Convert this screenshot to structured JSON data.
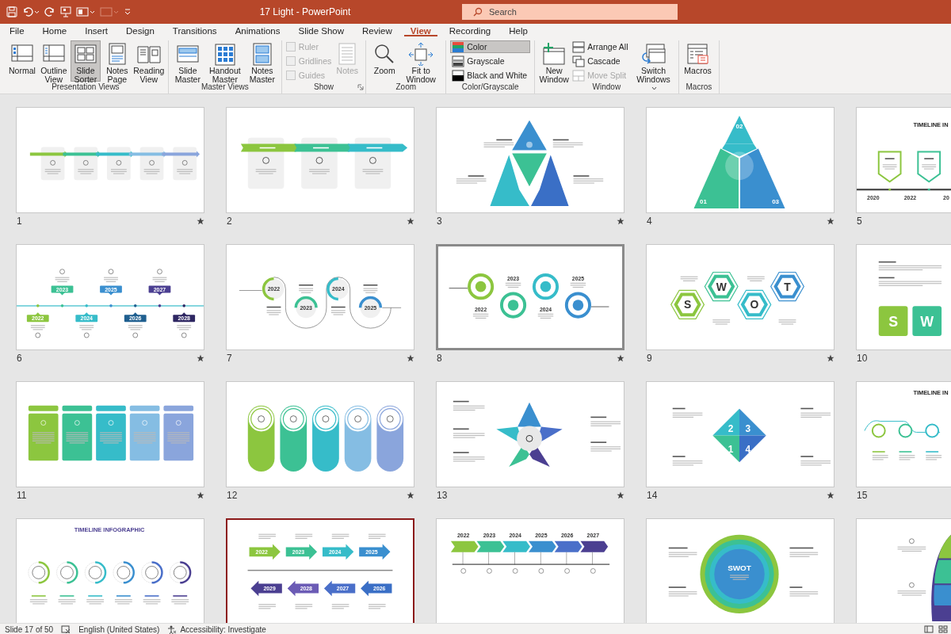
{
  "window": {
    "title": "17 Light  -  PowerPoint",
    "search": {
      "placeholder": "Search"
    }
  },
  "tabs": [
    {
      "label": "File",
      "selected": false
    },
    {
      "label": "Home",
      "selected": false
    },
    {
      "label": "Insert",
      "selected": false
    },
    {
      "label": "Design",
      "selected": false
    },
    {
      "label": "Transitions",
      "selected": false
    },
    {
      "label": "Animations",
      "selected": false
    },
    {
      "label": "Slide Show",
      "selected": false
    },
    {
      "label": "Review",
      "selected": false
    },
    {
      "label": "View",
      "selected": true
    },
    {
      "label": "Recording",
      "selected": false
    },
    {
      "label": "Help",
      "selected": false
    }
  ],
  "ribbon": [
    {
      "label": "Presentation Views",
      "items": [
        {
          "label": "Normal",
          "kind": "large",
          "selected": false,
          "disabled": false
        },
        {
          "label": "Outline View",
          "kind": "large",
          "selected": false,
          "disabled": false
        },
        {
          "label": "Slide Sorter",
          "kind": "large",
          "selected": true,
          "disabled": false
        },
        {
          "label": "Notes Page",
          "kind": "large",
          "selected": false,
          "disabled": false
        },
        {
          "label": "Reading View",
          "kind": "large",
          "selected": false,
          "disabled": false
        }
      ]
    },
    {
      "label": "Master Views",
      "items": [
        {
          "label": "Slide Master",
          "kind": "large",
          "selected": false,
          "disabled": false
        },
        {
          "label": "Handout Master",
          "kind": "large",
          "selected": false,
          "disabled": false
        },
        {
          "label": "Notes Master",
          "kind": "large",
          "selected": false,
          "disabled": false
        }
      ]
    },
    {
      "label": "Show",
      "items": [
        {
          "label": "Ruler",
          "kind": "check",
          "checked": false,
          "disabled": true
        },
        {
          "label": "Gridlines",
          "kind": "check",
          "checked": false,
          "disabled": true
        },
        {
          "label": "Guides",
          "kind": "check",
          "checked": false,
          "disabled": true
        },
        {
          "label": "Notes",
          "kind": "large",
          "selected": false,
          "disabled": true
        }
      ]
    },
    {
      "label": "Zoom",
      "items": [
        {
          "label": "Zoom",
          "kind": "large",
          "selected": false,
          "disabled": false
        },
        {
          "label": "Fit to Window",
          "kind": "large",
          "selected": false,
          "disabled": false
        }
      ]
    },
    {
      "label": "Color/Grayscale",
      "items": [
        {
          "label": "Color",
          "kind": "small",
          "selected": true,
          "disabled": false
        },
        {
          "label": "Grayscale",
          "kind": "small",
          "selected": false,
          "disabled": false
        },
        {
          "label": "Black and White",
          "kind": "small",
          "selected": false,
          "disabled": false
        }
      ]
    },
    {
      "label": "Window",
      "items": [
        {
          "label": "New Window",
          "kind": "large",
          "selected": false,
          "disabled": false
        },
        {
          "label": "Arrange All",
          "kind": "small",
          "selected": false,
          "disabled": false
        },
        {
          "label": "Cascade",
          "kind": "small",
          "selected": false,
          "disabled": false
        },
        {
          "label": "Move Split",
          "kind": "small",
          "selected": false,
          "disabled": true
        },
        {
          "label": "Switch Windows",
          "kind": "large",
          "selected": false,
          "disabled": false,
          "caret": true
        }
      ]
    },
    {
      "label": "Macros",
      "items": [
        {
          "label": "Macros",
          "kind": "large",
          "selected": false,
          "disabled": false
        }
      ]
    }
  ],
  "slides": [
    {
      "number": "1",
      "starred": true,
      "selected": false,
      "hovered": false,
      "kind": "cards"
    },
    {
      "number": "2",
      "starred": true,
      "selected": false,
      "hovered": false,
      "kind": "arrows"
    },
    {
      "number": "3",
      "starred": true,
      "selected": false,
      "hovered": false,
      "kind": "puzzle"
    },
    {
      "number": "4",
      "starred": true,
      "selected": false,
      "hovered": false,
      "kind": "pyramid",
      "labels": [
        "02",
        "01",
        "03"
      ]
    },
    {
      "number": "5",
      "selected": false,
      "hovered": false,
      "kind": "steps",
      "labels": [
        "TIMELINE IN",
        "2020",
        "2022",
        "20"
      ]
    },
    {
      "number": "6",
      "starred": true,
      "selected": false,
      "hovered": false,
      "kind": "timeline",
      "labels": [
        "2022",
        "2023",
        "2024",
        "2025",
        "2026",
        "2027",
        "2028"
      ]
    },
    {
      "number": "7",
      "starred": true,
      "selected": false,
      "hovered": false,
      "kind": "wave",
      "labels": [
        "2022",
        "2023",
        "2024",
        "2025"
      ]
    },
    {
      "number": "8",
      "starred": true,
      "selected": false,
      "hovered": true,
      "kind": "rings",
      "labels": [
        "2022",
        "2023",
        "2024",
        "2025"
      ]
    },
    {
      "number": "9",
      "starred": true,
      "selected": false,
      "hovered": false,
      "kind": "hexagons",
      "labels": [
        "S",
        "W",
        "O",
        "T"
      ]
    },
    {
      "number": "10",
      "selected": false,
      "hovered": false,
      "kind": "tiles",
      "labels": [
        "S",
        "W"
      ]
    },
    {
      "number": "11",
      "starred": true,
      "selected": false,
      "hovered": false,
      "kind": "tabcards"
    },
    {
      "number": "12",
      "starred": true,
      "selected": false,
      "hovered": false,
      "kind": "pills"
    },
    {
      "number": "13",
      "starred": true,
      "selected": false,
      "hovered": false,
      "kind": "star"
    },
    {
      "number": "14",
      "starred": true,
      "selected": false,
      "hovered": false,
      "kind": "diamond",
      "labels": [
        "2",
        "3",
        "1",
        "4"
      ]
    },
    {
      "number": "15",
      "selected": false,
      "hovered": false,
      "kind": "ringline",
      "labels": [
        "TIMELINE IN"
      ]
    },
    {
      "selected": false,
      "hovered": false,
      "kind": "circles",
      "labels": [
        "TIMELINE INFOGRAPHIC"
      ]
    },
    {
      "selected": true,
      "hovered": false,
      "kind": "arrowline",
      "labels": [
        "2022",
        "2023",
        "2024",
        "2025",
        "2029",
        "2028",
        "2027",
        "2026"
      ]
    },
    {
      "selected": false,
      "hovered": false,
      "kind": "chevrons",
      "labels": [
        "2022",
        "2023",
        "2024",
        "2025",
        "2026",
        "2027"
      ]
    },
    {
      "selected": false,
      "hovered": false,
      "kind": "swotcircle",
      "labels": [
        "SWOT"
      ]
    },
    {
      "selected": false,
      "hovered": false,
      "kind": "side"
    }
  ],
  "status_bar": {
    "slide": "Slide 17 of 50",
    "language": "English (United States)",
    "accessibility": "Accessibility: Investigate"
  }
}
